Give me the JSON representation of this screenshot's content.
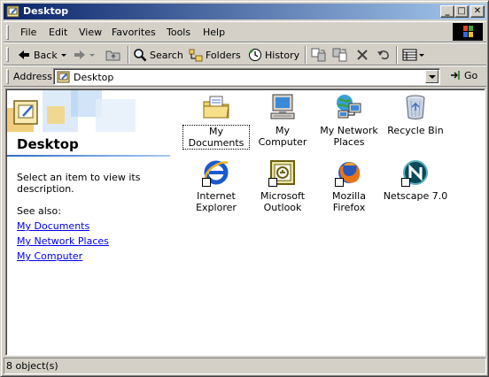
{
  "window": {
    "title": "Desktop",
    "minimize": "_",
    "maximize": "□",
    "close": "✕"
  },
  "menubar": {
    "items": [
      "File",
      "Edit",
      "View",
      "Favorites",
      "Tools",
      "Help"
    ]
  },
  "toolbar": {
    "back_label": "Back",
    "search_label": "Search",
    "folders_label": "Folders",
    "history_label": "History"
  },
  "address": {
    "label": "Address",
    "value": "Desktop",
    "go_label": "Go"
  },
  "webview": {
    "title": "Desktop",
    "description": "Select an item to view its description.",
    "see_also": "See also:",
    "links": [
      "My Documents",
      "My Network Places",
      "My Computer"
    ]
  },
  "icons": [
    {
      "label": "My Documents",
      "icon": "my-documents-icon"
    },
    {
      "label": "My Computer",
      "icon": "my-computer-icon"
    },
    {
      "label": "My Network Places",
      "icon": "network-places-icon"
    },
    {
      "label": "Recycle Bin",
      "icon": "recycle-bin-icon"
    },
    {
      "label": "Internet Explorer",
      "icon": "internet-explorer-icon"
    },
    {
      "label": "Microsoft Outlook",
      "icon": "outlook-icon"
    },
    {
      "label": "Mozilla Firefox",
      "icon": "firefox-icon"
    },
    {
      "label": "Netscape 7.0",
      "icon": "netscape-icon"
    }
  ],
  "status": {
    "text": "8 object(s)"
  },
  "colors": {
    "titlebar_start": "#0a246a",
    "titlebar_end": "#a6caf0",
    "link": "#0000ee",
    "face": "#d4d0c8"
  }
}
